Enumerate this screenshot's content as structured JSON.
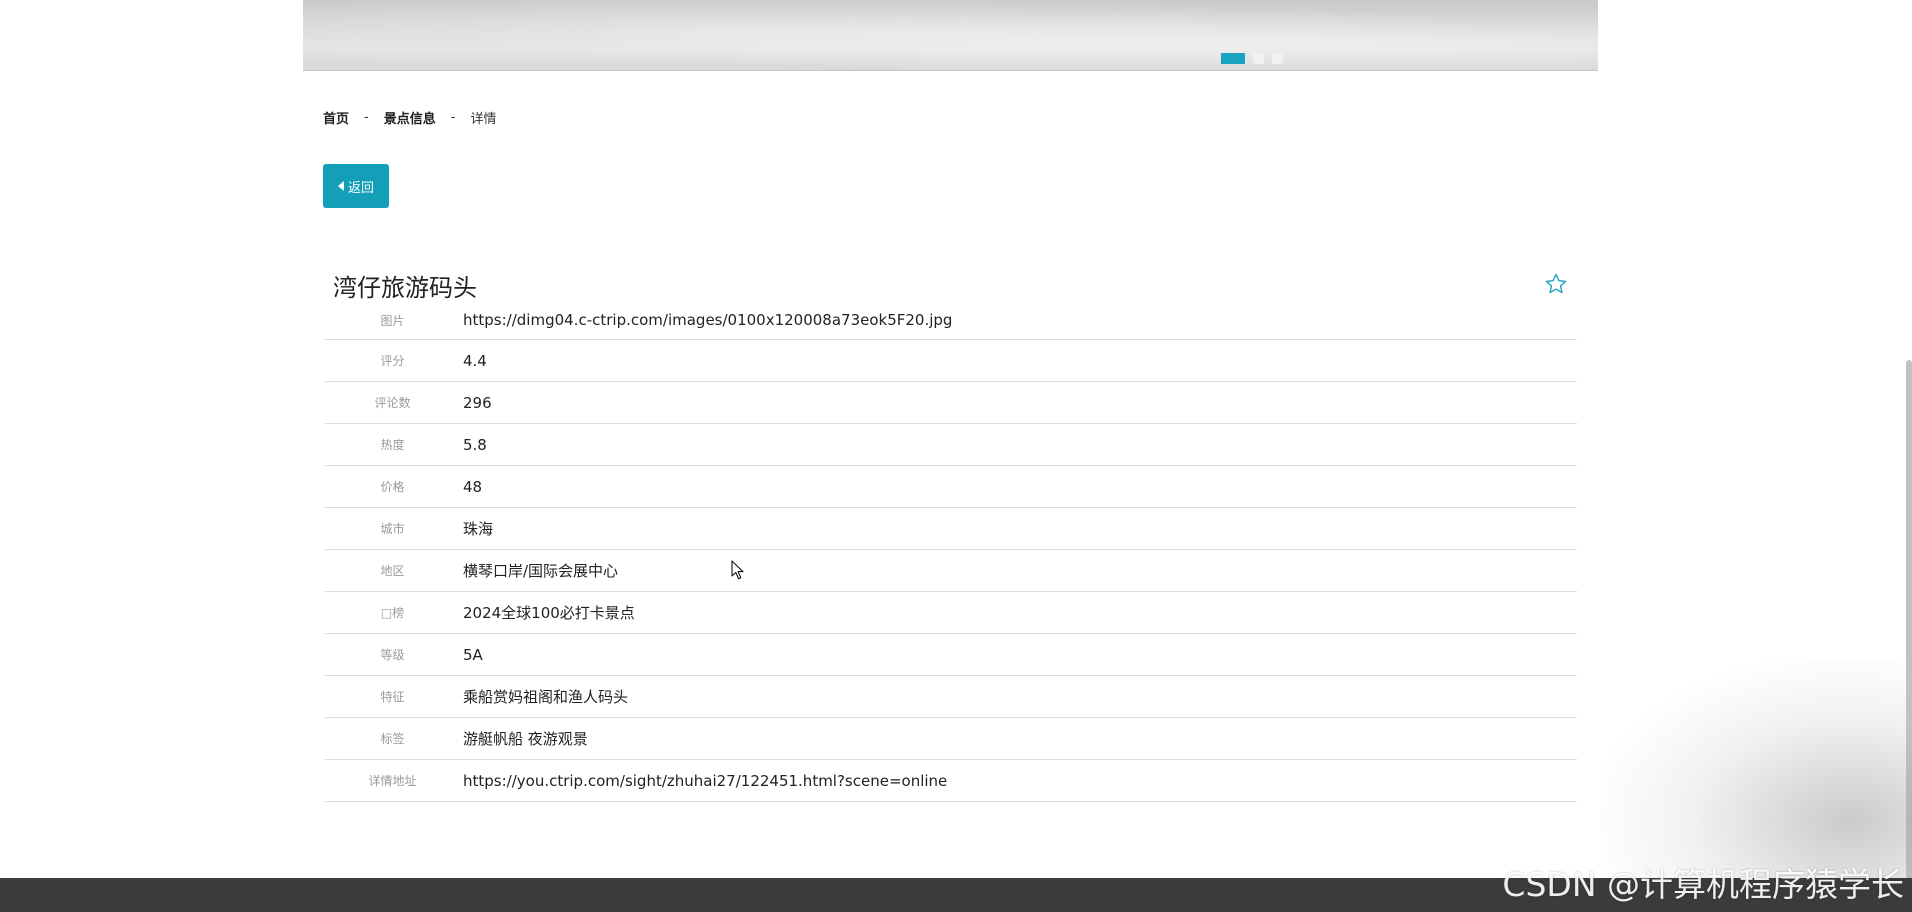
{
  "breadcrumb": {
    "home": "首页",
    "section": "景点信息",
    "current": "详情",
    "separator": "-"
  },
  "back_button": {
    "label": "返回"
  },
  "spot": {
    "title": "湾仔旅游码头"
  },
  "details": [
    {
      "label": "图片",
      "value": "https://dimg04.c-ctrip.com/images/0100x120008a73eok5F20.jpg"
    },
    {
      "label": "评分",
      "value": "4.4"
    },
    {
      "label": "评论数",
      "value": "296"
    },
    {
      "label": "热度",
      "value": "5.8"
    },
    {
      "label": "价格",
      "value": "48"
    },
    {
      "label": "城市",
      "value": "珠海"
    },
    {
      "label": "地区",
      "value": "横琴口岸/国际会展中心"
    },
    {
      "label": "□榜",
      "value": "2024全球100必打卡景点"
    },
    {
      "label": "等级",
      "value": "5A"
    },
    {
      "label": "特征",
      "value": "乘船赏妈祖阁和渔人码头"
    },
    {
      "label": "标签",
      "value": "游艇帆船 夜游观景"
    },
    {
      "label": "详情地址",
      "value": "https://you.ctrip.com/sight/zhuhai27/122451.html?scene=online"
    }
  ],
  "watermark": "CSDN @计算机程序猿学长",
  "colors": {
    "accent": "#149fb9",
    "footer": "#3a3b3d"
  },
  "carousel": {
    "slide_count": 3,
    "active_index": 0
  }
}
